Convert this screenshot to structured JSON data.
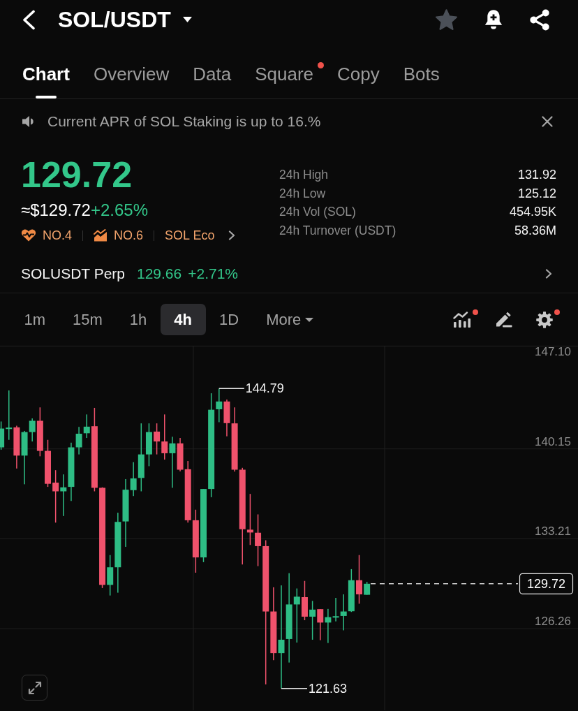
{
  "header": {
    "title": "SOL/USDT",
    "favorite": false
  },
  "tabs": [
    {
      "label": "Chart",
      "selected": true,
      "notification_dot": false
    },
    {
      "label": "Overview",
      "selected": false,
      "notification_dot": false
    },
    {
      "label": "Data",
      "selected": false,
      "notification_dot": false
    },
    {
      "label": "Square",
      "selected": false,
      "notification_dot": true
    },
    {
      "label": "Copy",
      "selected": false,
      "notification_dot": false
    },
    {
      "label": "Bots",
      "selected": false,
      "notification_dot": false
    }
  ],
  "announcement": {
    "text": "Current APR of SOL Staking is up to 16.%"
  },
  "ticker": {
    "price": "129.72",
    "usd_price": "≈$129.72",
    "change": "+2.65%",
    "tags": [
      {
        "kind": "heart",
        "label": "NO.4"
      },
      {
        "kind": "chart",
        "label": "NO.6"
      },
      {
        "kind": "text",
        "label": "SOL Eco"
      }
    ]
  },
  "stats": [
    {
      "label": "24h High",
      "value": "131.92"
    },
    {
      "label": "24h Low",
      "value": "125.12"
    },
    {
      "label": "24h Vol (SOL)",
      "value": "454.95K"
    },
    {
      "label": "24h Turnover (USDT)",
      "value": "58.36M"
    }
  ],
  "perpetual": {
    "name": "SOLUSDT Perp",
    "price": "129.66",
    "change": "+2.71%"
  },
  "intervals": [
    {
      "label": "1m",
      "selected": false,
      "kind": "interval"
    },
    {
      "label": "15m",
      "selected": false,
      "kind": "interval"
    },
    {
      "label": "1h",
      "selected": false,
      "kind": "interval"
    },
    {
      "label": "4h",
      "selected": true,
      "kind": "interval"
    },
    {
      "label": "1D",
      "selected": false,
      "kind": "interval"
    },
    {
      "label": "More",
      "selected": false,
      "kind": "menu"
    }
  ],
  "chart_tools": [
    {
      "kind": "indicators",
      "notification_dot": true
    },
    {
      "kind": "draw",
      "notification_dot": false
    },
    {
      "kind": "settings",
      "notification_dot": true
    }
  ],
  "chart": {
    "y_axis_labels": [
      "147.10",
      "140.15",
      "133.21",
      "126.26"
    ],
    "high_label": "144.79",
    "low_label": "121.63",
    "last_price_label": "129.72"
  }
}
